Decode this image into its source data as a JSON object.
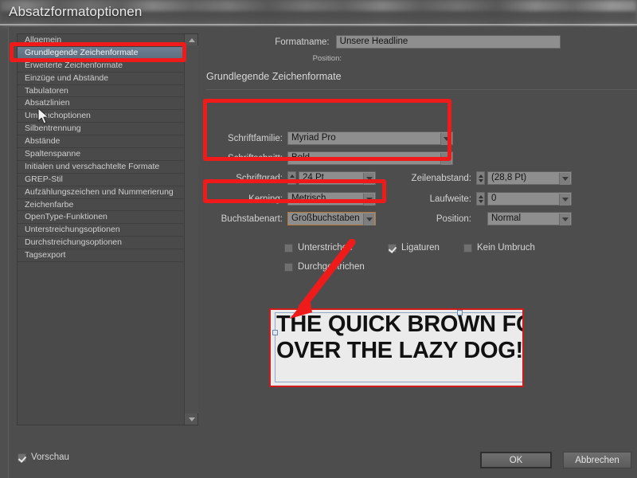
{
  "window": {
    "title": "Absatzformatoptionen"
  },
  "sidebar": {
    "items": [
      {
        "label": "Allgemein",
        "selected": false
      },
      {
        "label": "Grundlegende Zeichenformate",
        "selected": true
      },
      {
        "label": "Erweiterte Zeichenformate",
        "selected": false
      },
      {
        "label": "Einzüge und Abstände",
        "selected": false
      },
      {
        "label": "Tabulatoren",
        "selected": false
      },
      {
        "label": "Absatzlinien",
        "selected": false
      },
      {
        "label": "Umbruchoptionen",
        "selected": false
      },
      {
        "label": "Silbentrennung",
        "selected": false
      },
      {
        "label": "Abstände",
        "selected": false
      },
      {
        "label": "Spaltenspanne",
        "selected": false
      },
      {
        "label": "Initialen und verschachtelte Formate",
        "selected": false
      },
      {
        "label": "GREP-Stil",
        "selected": false
      },
      {
        "label": "Aufzählungszeichen und Nummerierung",
        "selected": false
      },
      {
        "label": "Zeichenfarbe",
        "selected": false
      },
      {
        "label": "OpenType-Funktionen",
        "selected": false
      },
      {
        "label": "Unterstreichungsoptionen",
        "selected": false
      },
      {
        "label": "Durchstreichungsoptionen",
        "selected": false
      },
      {
        "label": "Tagsexport",
        "selected": false
      }
    ],
    "scroll_up_icon": "triangle-up-icon",
    "scroll_down_icon": "triangle-down-icon"
  },
  "header": {
    "format_name_label": "Formatname:",
    "format_name_value": "Unsere Headline",
    "position_label": "Position:",
    "section_title": "Grundlegende Zeichenformate"
  },
  "fields": {
    "font_family_label": "Schriftfamilie:",
    "font_family_value": "Myriad Pro",
    "font_style_label": "Schriftschnitt:",
    "font_style_value": "Bold",
    "font_size_label": "Schriftgrad:",
    "font_size_value": "24 Pt",
    "leading_label": "Zeilenabstand:",
    "leading_value": "(28,8 Pt)",
    "kerning_label": "Kerning:",
    "kerning_value": "Metrisch",
    "tracking_label": "Laufweite:",
    "tracking_value": "0",
    "case_label": "Buchstabenart:",
    "case_value": "Großbuchstaben",
    "position_label": "Position:",
    "position_value": "Normal"
  },
  "checkboxes": [
    {
      "label": "Unterstrichen",
      "checked": false
    },
    {
      "label": "Ligaturen",
      "checked": true
    },
    {
      "label": "Kein Umbruch",
      "checked": false
    },
    {
      "label": "Durchgestrichen",
      "checked": false
    }
  ],
  "preview": {
    "line1": "THE QUICK BROWN FO",
    "line2": "OVER THE LAZY DOG!"
  },
  "footer": {
    "preview_label": "Vorschau",
    "preview_checked": true,
    "ok_label": "OK",
    "cancel_label": "Abbrechen"
  },
  "annotation": {
    "color": "#ef1b1b",
    "arrow_icon": "red-arrow-icon"
  }
}
